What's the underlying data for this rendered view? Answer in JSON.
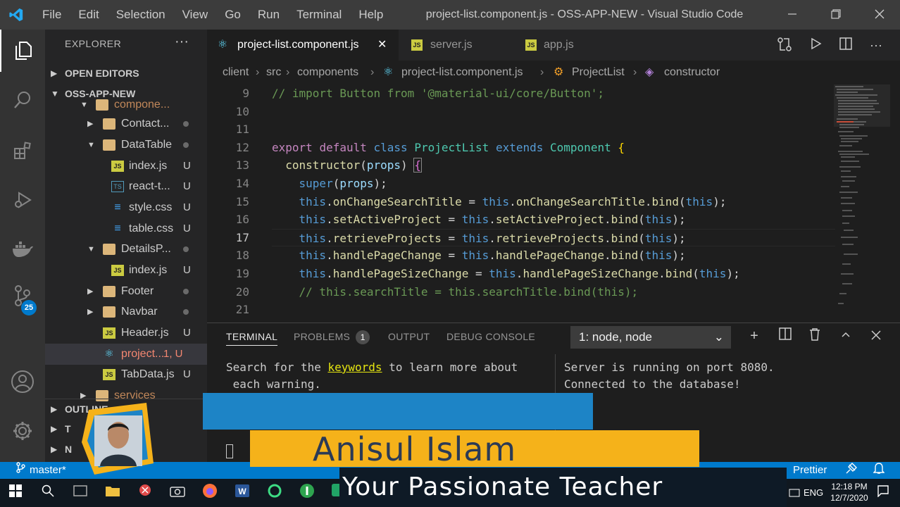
{
  "window": {
    "title": "project-list.component.js - OSS-APP-NEW - Visual Studio Code",
    "menu": [
      "File",
      "Edit",
      "Selection",
      "View",
      "Go",
      "Run",
      "Terminal",
      "Help"
    ]
  },
  "activity_bar": {
    "icons": [
      "files-icon",
      "search-icon",
      "extensions-icon",
      "run-debug-icon",
      "docker-icon",
      "source-control-icon",
      "account-icon",
      "settings-gear-icon"
    ],
    "source_control_badge": "25"
  },
  "sidebar": {
    "header": "EXPLORER",
    "sections": {
      "open_editors": "OPEN EDITORS",
      "project": "OSS-APP-NEW",
      "outline": "OUTLINE",
      "timeline": "T",
      "npm": "N"
    },
    "tree": [
      {
        "name": "compone...",
        "type": "folder",
        "status": ""
      },
      {
        "name": "Contact...",
        "type": "folder",
        "status": ""
      },
      {
        "name": "DataTable",
        "type": "folder",
        "status": ""
      },
      {
        "name": "index.js",
        "type": "js",
        "status": "U"
      },
      {
        "name": "react-t...",
        "type": "ts",
        "status": "U"
      },
      {
        "name": "style.css",
        "type": "css",
        "status": "U"
      },
      {
        "name": "table.css",
        "type": "css",
        "status": "U"
      },
      {
        "name": "DetailsP...",
        "type": "folder",
        "status": ""
      },
      {
        "name": "index.js",
        "type": "js",
        "status": "U"
      },
      {
        "name": "Footer",
        "type": "folder",
        "status": ""
      },
      {
        "name": "Navbar",
        "type": "folder",
        "status": ""
      },
      {
        "name": "Header.js",
        "type": "js",
        "status": "U"
      },
      {
        "name": "project...",
        "type": "react",
        "status": "1, U"
      },
      {
        "name": "TabData.js",
        "type": "js",
        "status": "U"
      },
      {
        "name": "services",
        "type": "folder",
        "status": ""
      }
    ]
  },
  "tabs": [
    {
      "label": "project-list.component.js",
      "active": true,
      "icon": "react-icon"
    },
    {
      "label": "server.js",
      "active": false,
      "icon": "js-icon"
    },
    {
      "label": "app.js",
      "active": false,
      "icon": "js-icon"
    }
  ],
  "breadcrumbs": [
    "client",
    "src",
    "components",
    "project-list.component.js",
    "ProjectList",
    "constructor"
  ],
  "editor": {
    "lines": [
      {
        "n": "9",
        "text": "// import Button from '@material-ui/core/Button';"
      },
      {
        "n": "10",
        "text": ""
      },
      {
        "n": "11",
        "text": ""
      },
      {
        "n": "12",
        "text": "export default class ProjectList extends Component {"
      },
      {
        "n": "13",
        "text": "  constructor(props) {"
      },
      {
        "n": "14",
        "text": "    super(props);"
      },
      {
        "n": "15",
        "text": "    this.onChangeSearchTitle = this.onChangeSearchTitle.bind(this);"
      },
      {
        "n": "16",
        "text": "    this.setActiveProject = this.setActiveProject.bind(this);"
      },
      {
        "n": "17",
        "text": "    this.retrieveProjects = this.retrieveProjects.bind(this);"
      },
      {
        "n": "18",
        "text": "    this.handlePageChange = this.handlePageChange.bind(this);"
      },
      {
        "n": "19",
        "text": "    this.handlePageSizeChange = this.handlePageSizeChange.bind(this);"
      },
      {
        "n": "20",
        "text": "    // this.searchTitle = this.searchTitle.bind(this);"
      },
      {
        "n": "21",
        "text": ""
      }
    ]
  },
  "panel": {
    "tabs": {
      "terminal": "TERMINAL",
      "problems": "PROBLEMS",
      "problems_count": "1",
      "output": "OUTPUT",
      "debug": "DEBUG CONSOLE"
    },
    "terminal_select": "1: node, node",
    "left_terminal": {
      "pre": "Search for the ",
      "link": "keywords",
      "post": " to learn more about",
      "line2": " each warning."
    },
    "right_terminal": {
      "line1": "Server is running on port 8080.",
      "line2": "Connected to the database!"
    }
  },
  "status_bar": {
    "branch": "master*",
    "prettier": "Prettier"
  },
  "taskbar": {
    "lang": "ENG",
    "time": "12:18 PM",
    "date": "12/7/2020"
  },
  "overlay": {
    "name": "Anisul Islam",
    "subtitle": "Your Passionate Teacher"
  },
  "colors": {
    "accent": "#007acc",
    "overlay_blue": "#1d84c6",
    "overlay_yellow": "#f5b21a"
  }
}
